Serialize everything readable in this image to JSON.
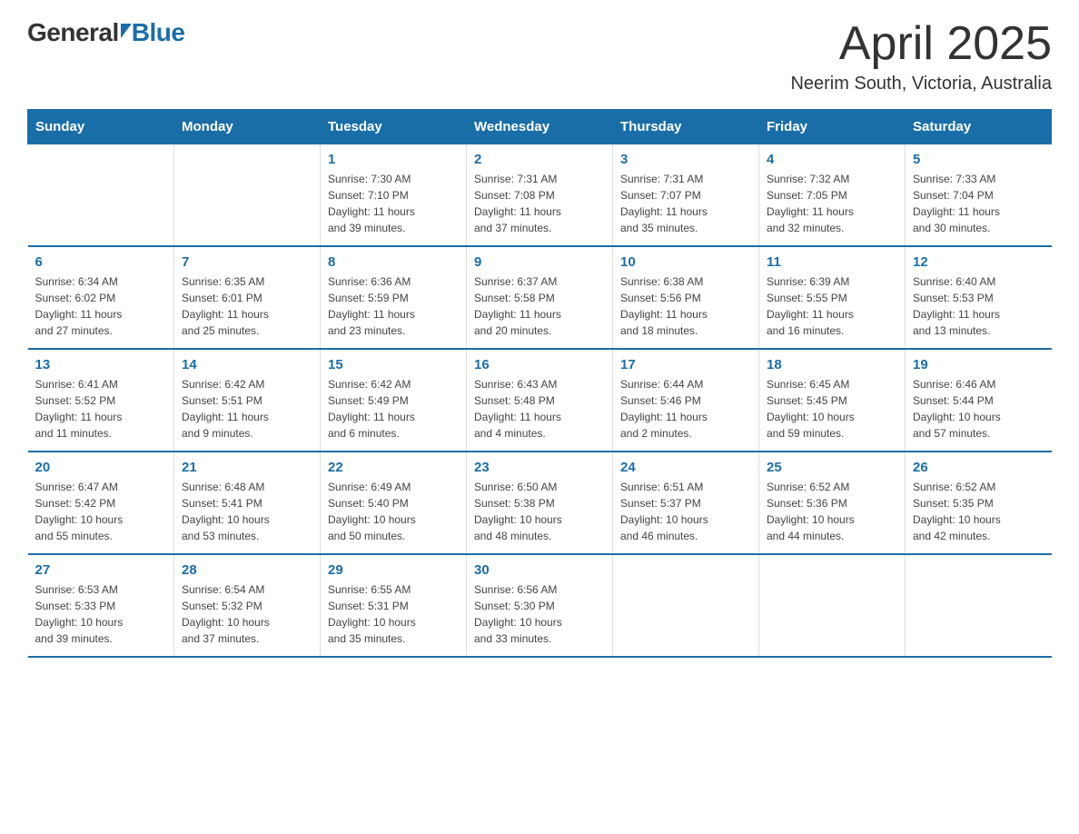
{
  "header": {
    "logo_general": "General",
    "logo_blue": "Blue",
    "month_title": "April 2025",
    "location": "Neerim South, Victoria, Australia"
  },
  "days_of_week": [
    "Sunday",
    "Monday",
    "Tuesday",
    "Wednesday",
    "Thursday",
    "Friday",
    "Saturday"
  ],
  "weeks": [
    [
      {
        "day": "",
        "sunrise": "",
        "sunset": "",
        "daylight": ""
      },
      {
        "day": "",
        "sunrise": "",
        "sunset": "",
        "daylight": ""
      },
      {
        "day": "1",
        "sunrise": "Sunrise: 7:30 AM",
        "sunset": "Sunset: 7:10 PM",
        "daylight": "Daylight: 11 hours and 39 minutes."
      },
      {
        "day": "2",
        "sunrise": "Sunrise: 7:31 AM",
        "sunset": "Sunset: 7:08 PM",
        "daylight": "Daylight: 11 hours and 37 minutes."
      },
      {
        "day": "3",
        "sunrise": "Sunrise: 7:31 AM",
        "sunset": "Sunset: 7:07 PM",
        "daylight": "Daylight: 11 hours and 35 minutes."
      },
      {
        "day": "4",
        "sunrise": "Sunrise: 7:32 AM",
        "sunset": "Sunset: 7:05 PM",
        "daylight": "Daylight: 11 hours and 32 minutes."
      },
      {
        "day": "5",
        "sunrise": "Sunrise: 7:33 AM",
        "sunset": "Sunset: 7:04 PM",
        "daylight": "Daylight: 11 hours and 30 minutes."
      }
    ],
    [
      {
        "day": "6",
        "sunrise": "Sunrise: 6:34 AM",
        "sunset": "Sunset: 6:02 PM",
        "daylight": "Daylight: 11 hours and 27 minutes."
      },
      {
        "day": "7",
        "sunrise": "Sunrise: 6:35 AM",
        "sunset": "Sunset: 6:01 PM",
        "daylight": "Daylight: 11 hours and 25 minutes."
      },
      {
        "day": "8",
        "sunrise": "Sunrise: 6:36 AM",
        "sunset": "Sunset: 5:59 PM",
        "daylight": "Daylight: 11 hours and 23 minutes."
      },
      {
        "day": "9",
        "sunrise": "Sunrise: 6:37 AM",
        "sunset": "Sunset: 5:58 PM",
        "daylight": "Daylight: 11 hours and 20 minutes."
      },
      {
        "day": "10",
        "sunrise": "Sunrise: 6:38 AM",
        "sunset": "Sunset: 5:56 PM",
        "daylight": "Daylight: 11 hours and 18 minutes."
      },
      {
        "day": "11",
        "sunrise": "Sunrise: 6:39 AM",
        "sunset": "Sunset: 5:55 PM",
        "daylight": "Daylight: 11 hours and 16 minutes."
      },
      {
        "day": "12",
        "sunrise": "Sunrise: 6:40 AM",
        "sunset": "Sunset: 5:53 PM",
        "daylight": "Daylight: 11 hours and 13 minutes."
      }
    ],
    [
      {
        "day": "13",
        "sunrise": "Sunrise: 6:41 AM",
        "sunset": "Sunset: 5:52 PM",
        "daylight": "Daylight: 11 hours and 11 minutes."
      },
      {
        "day": "14",
        "sunrise": "Sunrise: 6:42 AM",
        "sunset": "Sunset: 5:51 PM",
        "daylight": "Daylight: 11 hours and 9 minutes."
      },
      {
        "day": "15",
        "sunrise": "Sunrise: 6:42 AM",
        "sunset": "Sunset: 5:49 PM",
        "daylight": "Daylight: 11 hours and 6 minutes."
      },
      {
        "day": "16",
        "sunrise": "Sunrise: 6:43 AM",
        "sunset": "Sunset: 5:48 PM",
        "daylight": "Daylight: 11 hours and 4 minutes."
      },
      {
        "day": "17",
        "sunrise": "Sunrise: 6:44 AM",
        "sunset": "Sunset: 5:46 PM",
        "daylight": "Daylight: 11 hours and 2 minutes."
      },
      {
        "day": "18",
        "sunrise": "Sunrise: 6:45 AM",
        "sunset": "Sunset: 5:45 PM",
        "daylight": "Daylight: 10 hours and 59 minutes."
      },
      {
        "day": "19",
        "sunrise": "Sunrise: 6:46 AM",
        "sunset": "Sunset: 5:44 PM",
        "daylight": "Daylight: 10 hours and 57 minutes."
      }
    ],
    [
      {
        "day": "20",
        "sunrise": "Sunrise: 6:47 AM",
        "sunset": "Sunset: 5:42 PM",
        "daylight": "Daylight: 10 hours and 55 minutes."
      },
      {
        "day": "21",
        "sunrise": "Sunrise: 6:48 AM",
        "sunset": "Sunset: 5:41 PM",
        "daylight": "Daylight: 10 hours and 53 minutes."
      },
      {
        "day": "22",
        "sunrise": "Sunrise: 6:49 AM",
        "sunset": "Sunset: 5:40 PM",
        "daylight": "Daylight: 10 hours and 50 minutes."
      },
      {
        "day": "23",
        "sunrise": "Sunrise: 6:50 AM",
        "sunset": "Sunset: 5:38 PM",
        "daylight": "Daylight: 10 hours and 48 minutes."
      },
      {
        "day": "24",
        "sunrise": "Sunrise: 6:51 AM",
        "sunset": "Sunset: 5:37 PM",
        "daylight": "Daylight: 10 hours and 46 minutes."
      },
      {
        "day": "25",
        "sunrise": "Sunrise: 6:52 AM",
        "sunset": "Sunset: 5:36 PM",
        "daylight": "Daylight: 10 hours and 44 minutes."
      },
      {
        "day": "26",
        "sunrise": "Sunrise: 6:52 AM",
        "sunset": "Sunset: 5:35 PM",
        "daylight": "Daylight: 10 hours and 42 minutes."
      }
    ],
    [
      {
        "day": "27",
        "sunrise": "Sunrise: 6:53 AM",
        "sunset": "Sunset: 5:33 PM",
        "daylight": "Daylight: 10 hours and 39 minutes."
      },
      {
        "day": "28",
        "sunrise": "Sunrise: 6:54 AM",
        "sunset": "Sunset: 5:32 PM",
        "daylight": "Daylight: 10 hours and 37 minutes."
      },
      {
        "day": "29",
        "sunrise": "Sunrise: 6:55 AM",
        "sunset": "Sunset: 5:31 PM",
        "daylight": "Daylight: 10 hours and 35 minutes."
      },
      {
        "day": "30",
        "sunrise": "Sunrise: 6:56 AM",
        "sunset": "Sunset: 5:30 PM",
        "daylight": "Daylight: 10 hours and 33 minutes."
      },
      {
        "day": "",
        "sunrise": "",
        "sunset": "",
        "daylight": ""
      },
      {
        "day": "",
        "sunrise": "",
        "sunset": "",
        "daylight": ""
      },
      {
        "day": "",
        "sunrise": "",
        "sunset": "",
        "daylight": ""
      }
    ]
  ]
}
